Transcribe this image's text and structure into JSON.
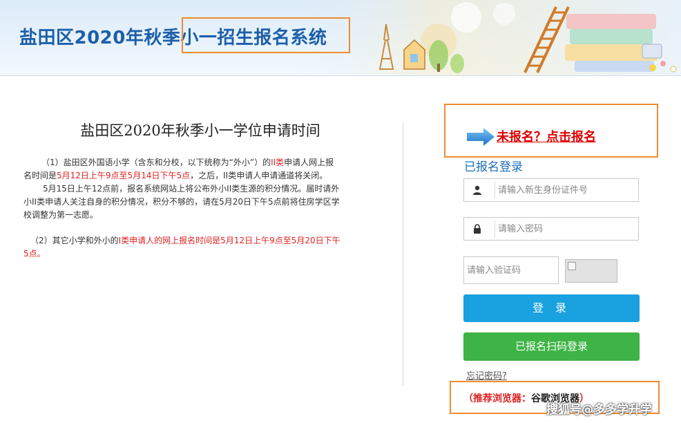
{
  "header": {
    "title_part1": "盐田区2020年秋季",
    "title_part2": "小一招生报名系统"
  },
  "notice": {
    "title": "盐田区2020年秋季小一学位申请时间",
    "p1_a": "（1）盐田区外国语小学（含东和分校，以下统称为“外小”）的",
    "p1_b": "II类",
    "p1_c": "申请人网上报名时间是",
    "p1_d": "5月12日上午9点至5月14日下午5点",
    "p1_e": "，之后，II类申请人申请通道将关闭。",
    "p2": "5月15日上午12点前，报名系统网站上将公布外小II类生源的积分情况。届时请外小II类申请人关注自身的积分情况，积分不够的，请在5月20日下午5点前将住房学区学校调整为第一志愿。",
    "p3_a": "（2）其它小学和外小的",
    "p3_b": "I类申请人的网上报名时间是5月12日上午9点至5月20日下午5点。"
  },
  "register": {
    "link_label": "未报名？点击报名"
  },
  "login": {
    "title": "已报名登录",
    "id_placeholder": "请输入新生身份证件号",
    "password_placeholder": "请输入密码",
    "captcha_placeholder": "请输入验证码",
    "login_button": "登 录",
    "scan_button": "已报名扫码登录",
    "forgot_link": "忘记密码?",
    "browser_label": "（推荐浏览器：",
    "browser_name": "谷歌浏览器",
    "browser_end": "）"
  },
  "watermark": "搜狐号@多多学升学",
  "colors": {
    "title_blue": "#1d5faa",
    "highlight_orange": "#ef8b2d",
    "alert_red": "#e02020",
    "login_blue": "#1aa1e0",
    "scan_green": "#3db445"
  }
}
